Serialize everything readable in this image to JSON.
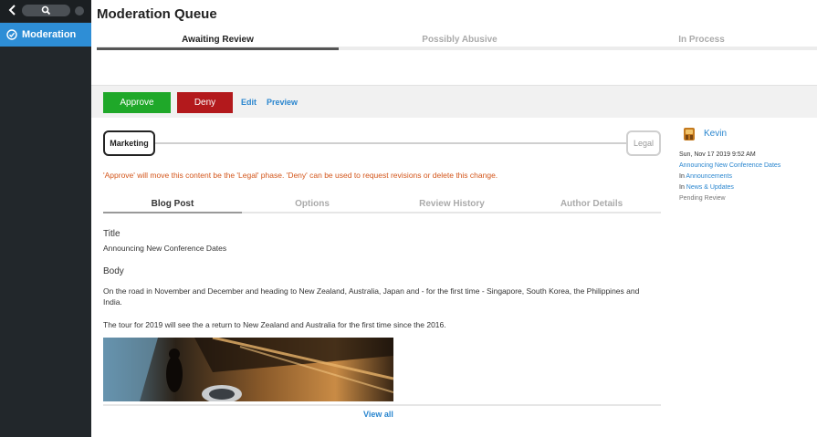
{
  "sidebar": {
    "items": [
      {
        "label": "Moderation"
      }
    ]
  },
  "page": {
    "title": "Moderation Queue",
    "tabs": [
      {
        "label": "Awaiting Review"
      },
      {
        "label": "Possibly Abusive"
      },
      {
        "label": "In Process"
      }
    ]
  },
  "actions": {
    "approve": "Approve",
    "deny": "Deny",
    "edit": "Edit",
    "preview": "Preview"
  },
  "workflow": {
    "current": "Marketing",
    "next": "Legal",
    "notice": "'Approve' will move this content be the 'Legal' phase. 'Deny' can be used to request revisions or delete this change."
  },
  "content_tabs": [
    {
      "label": "Blog Post"
    },
    {
      "label": "Options"
    },
    {
      "label": "Review History"
    },
    {
      "label": "Author Details"
    }
  ],
  "post": {
    "title_label": "Title",
    "title_value": "Announcing New Conference Dates",
    "body_label": "Body",
    "body_p1": "On the road in November and December and heading to New Zealand, Australia, Japan and - for the first time - Singapore, South Korea, the Philippines and India.",
    "body_p2": "The tour for 2019 will see the a return to New Zealand and Australia for the first time since the 2016.",
    "view_all": "View all"
  },
  "details": {
    "author": "Kevin",
    "datetime": "Sun, Nov 17 2019 9:52 AM",
    "post_title": "Announcing New Conference Dates",
    "in_label": "In",
    "location1": "Announcements",
    "location2": "News & Updates",
    "status": "Pending Review"
  },
  "colors": {
    "accent": "#2e8ed6",
    "approve": "#1fa829",
    "deny": "#b3191c",
    "notice": "#d3551a",
    "sidebar": "#22272b"
  }
}
